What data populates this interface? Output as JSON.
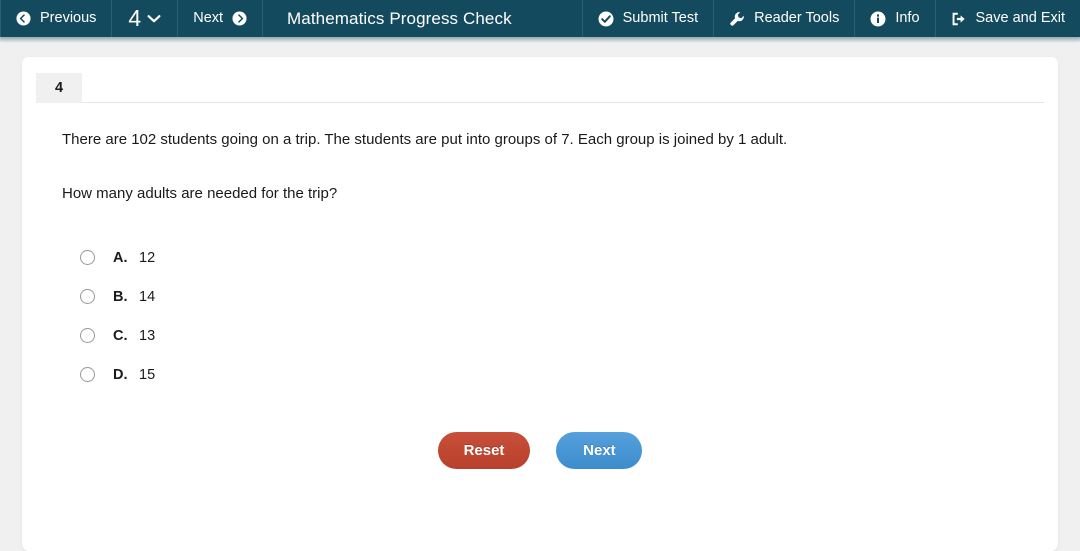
{
  "topbar": {
    "previous_label": "Previous",
    "question_number": "4",
    "next_label": "Next",
    "test_title": "Mathematics Progress Check",
    "submit_label": "Submit Test",
    "reader_tools_label": "Reader Tools",
    "info_label": "Info",
    "save_exit_label": "Save and Exit",
    "background_color": "#134a5e"
  },
  "question": {
    "number_badge": "4",
    "stem_line_1": "There are 102 students going on a trip. The students are put into groups of 7. Each group is joined by 1 adult.",
    "stem_line_2": "How many adults are needed for the trip?",
    "options": [
      {
        "letter": "A.",
        "text": "12",
        "selected": false
      },
      {
        "letter": "B.",
        "text": "14",
        "selected": false
      },
      {
        "letter": "C.",
        "text": "13",
        "selected": false
      },
      {
        "letter": "D.",
        "text": "15",
        "selected": false
      }
    ]
  },
  "actions": {
    "reset_label": "Reset",
    "reset_color": "#c0482f",
    "next_label": "Next",
    "next_color": "#4594d4"
  }
}
